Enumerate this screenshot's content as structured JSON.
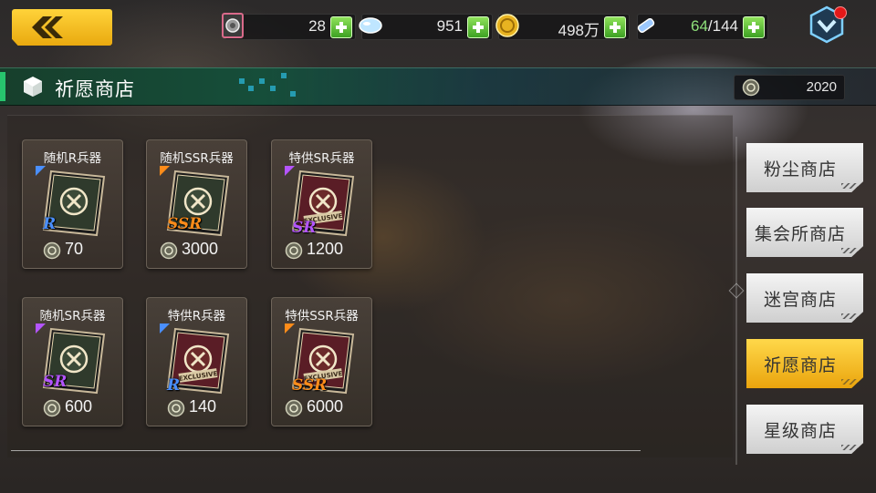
{
  "header": {
    "back_label": "",
    "resources": {
      "token": "28",
      "diamond": "951",
      "gold": "498万",
      "stamina_current": "64",
      "stamina_max": "/144"
    }
  },
  "shop": {
    "title": "祈愿商店",
    "currency_balance": "2020"
  },
  "items": [
    {
      "name": "随机R兵器",
      "rarity": "R",
      "price": "70",
      "rarity_color": "#4a8fff",
      "exclusive": false
    },
    {
      "name": "随机SSR兵器",
      "rarity": "SSR",
      "price": "3000",
      "rarity_color": "#ff8c1a",
      "exclusive": false
    },
    {
      "name": "特供SR兵器",
      "rarity": "SR",
      "price": "1200",
      "rarity_color": "#b455ff",
      "exclusive": true
    },
    {
      "name": "随机SR兵器",
      "rarity": "SR",
      "price": "600",
      "rarity_color": "#b455ff",
      "exclusive": false
    },
    {
      "name": "特供R兵器",
      "rarity": "R",
      "price": "140",
      "rarity_color": "#4a8fff",
      "exclusive": true
    },
    {
      "name": "特供SSR兵器",
      "rarity": "SSR",
      "price": "6000",
      "rarity_color": "#ff8c1a",
      "exclusive": true
    }
  ],
  "book_texts": {
    "exclusive": "EXCLUSIVE"
  },
  "tabs": [
    {
      "label": "粉尘商店",
      "active": false
    },
    {
      "label": "集会所商店",
      "active": false
    },
    {
      "label": "迷宫商店",
      "active": false
    },
    {
      "label": "祈愿商店",
      "active": true
    },
    {
      "label": "星级商店",
      "active": false
    }
  ]
}
